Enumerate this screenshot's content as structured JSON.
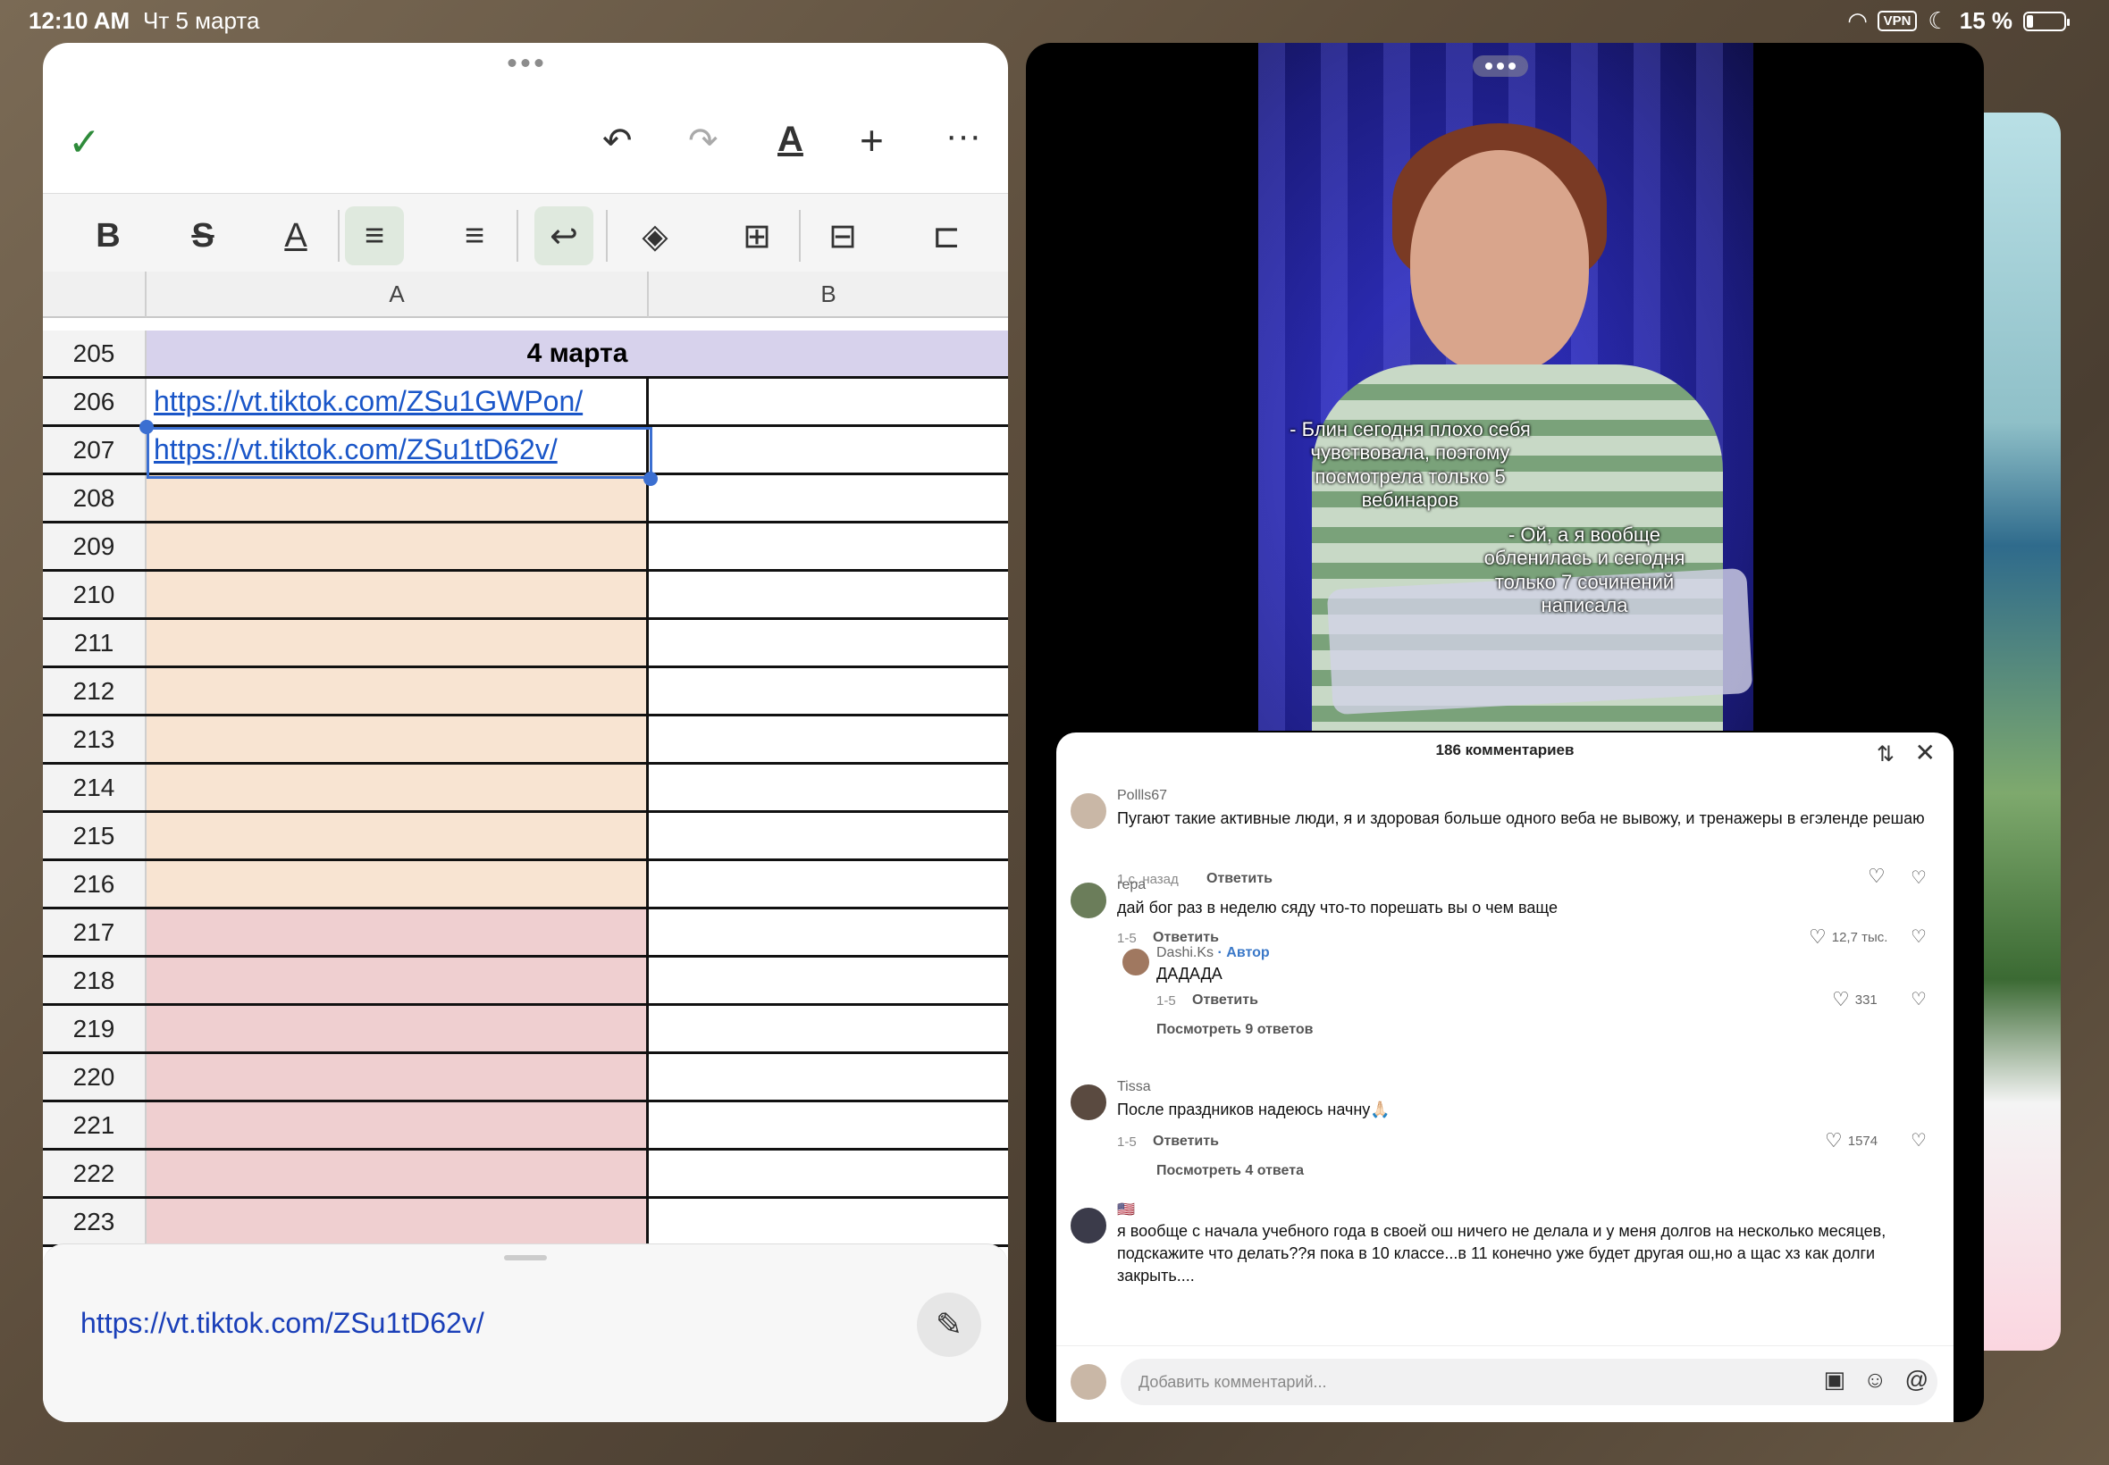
{
  "status_bar": {
    "time": "12:10 AM",
    "date": "Чт 5 марта",
    "vpn": "VPN",
    "battery": "15 %"
  },
  "spreadsheet": {
    "columns": [
      "A",
      "B"
    ],
    "rows": [
      {
        "num": "205",
        "a": "4 марта",
        "type": "header"
      },
      {
        "num": "206",
        "a": "https://vt.tiktok.com/ZSu1GWPon/",
        "type": "link"
      },
      {
        "num": "207",
        "a": "https://vt.tiktok.com/ZSu1tD62v/",
        "type": "link"
      },
      {
        "num": "208",
        "a": "",
        "type": "peach"
      },
      {
        "num": "209",
        "a": "",
        "type": "peach"
      },
      {
        "num": "210",
        "a": "",
        "type": "peach"
      },
      {
        "num": "211",
        "a": "",
        "type": "peach"
      },
      {
        "num": "212",
        "a": "",
        "type": "peach"
      },
      {
        "num": "213",
        "a": "",
        "type": "peach"
      },
      {
        "num": "214",
        "a": "",
        "type": "peach"
      },
      {
        "num": "215",
        "a": "",
        "type": "peach"
      },
      {
        "num": "216",
        "a": "",
        "type": "peach"
      },
      {
        "num": "217",
        "a": "",
        "type": "rose"
      },
      {
        "num": "218",
        "a": "",
        "type": "rose"
      },
      {
        "num": "219",
        "a": "",
        "type": "rose"
      },
      {
        "num": "220",
        "a": "",
        "type": "rose"
      },
      {
        "num": "221",
        "a": "",
        "type": "rose"
      },
      {
        "num": "222",
        "a": "",
        "type": "rose"
      },
      {
        "num": "223",
        "a": "",
        "type": "rose"
      }
    ],
    "cell_editor_value": "https://vt.tiktok.com/ZSu1tD62v/"
  },
  "video": {
    "caption_1": "- Блин сегодня плохо себя чувствовала, поэтому посмотрела только 5 вебинаров",
    "caption_2": "- Ой, а я вообще обленилась и сегодня только 7 сочинений написала"
  },
  "comments": {
    "header": "186 комментариев",
    "items": [
      {
        "user": "Pollls67",
        "text": "Пугают такие активные люди, я и здоровая больше одного веба не вывожу, и тренажеры в егэленде решаю",
        "time": "1 с. назад",
        "reply": "Ответить"
      },
      {
        "user": "гера",
        "text": "дай бог раз в неделю сяду что-то порешать вы о чем ваще",
        "time": "1-5",
        "reply": "Ответить",
        "likes": "12,7 тыс."
      },
      {
        "user": "Dashi.Ks",
        "badge": "· Автор",
        "text": "ДАДАДА",
        "time": "1-5",
        "reply": "Ответить",
        "likes": "331",
        "more": "Посмотреть 9 ответов"
      },
      {
        "user": "Tissa",
        "text": "После праздников надеюсь начну🙏🏻",
        "time": "1-5",
        "reply": "Ответить",
        "likes": "1574",
        "more": "Посмотреть 4 ответа"
      },
      {
        "user": "🇺🇸",
        "text": "я вообще с начала учебного года в своей ош ничего не делала и у меня долгов на несколько месяцев, подскажите что делать??я пока в 10 классе...в 11 конечно уже будет другая ош,но а щас хз как долги закрыть...."
      }
    ],
    "add_placeholder": "Добавить комментарий..."
  }
}
